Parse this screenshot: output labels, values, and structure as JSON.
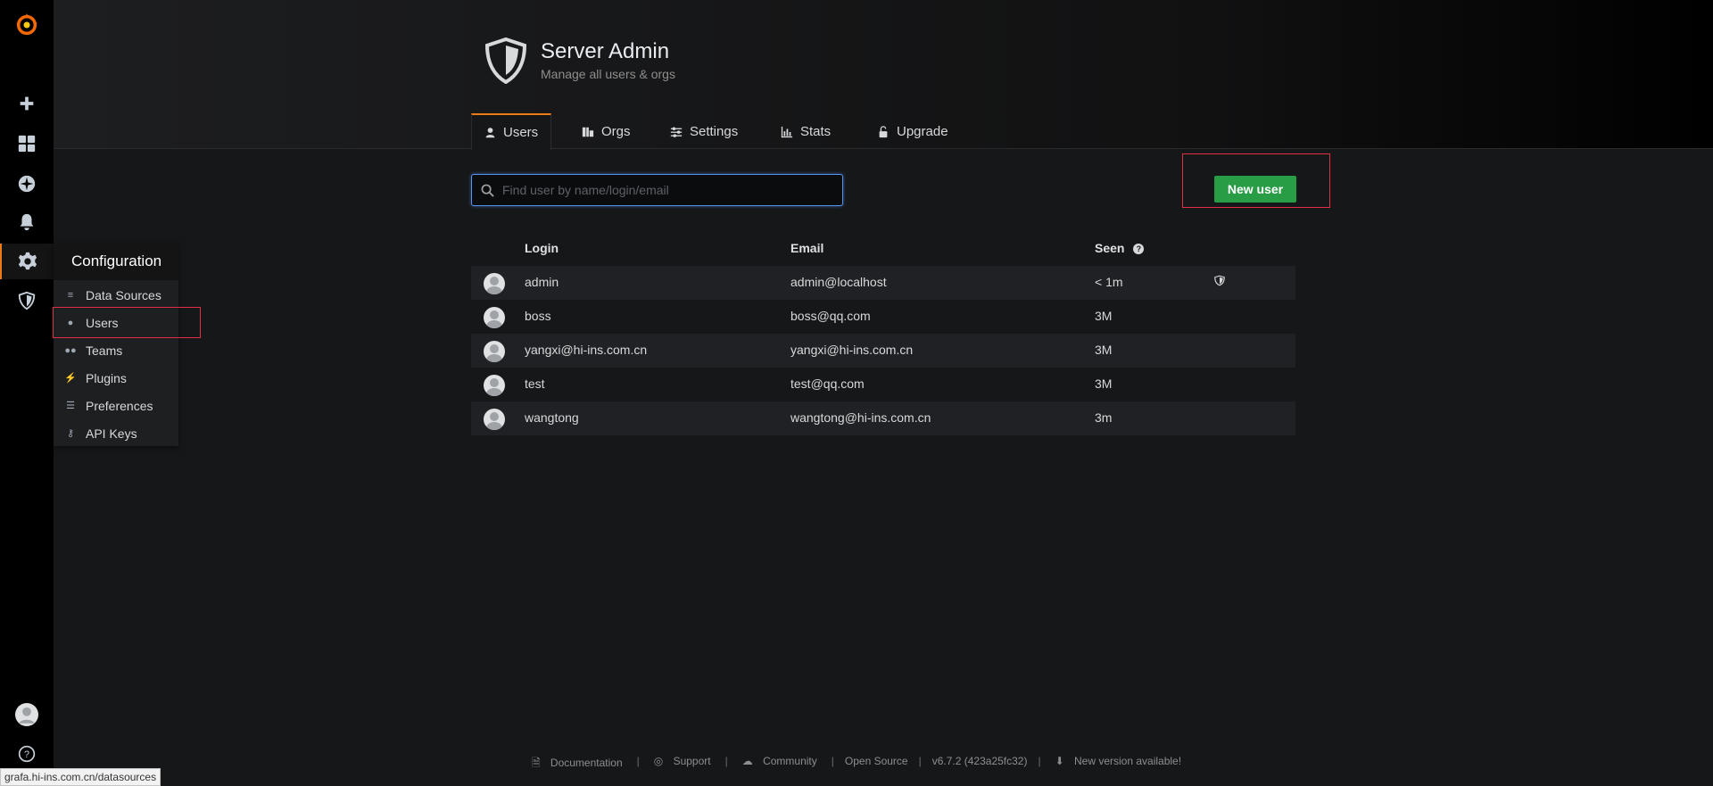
{
  "sidebar": {
    "icons": [
      "grafana-logo-icon",
      "plus-icon",
      "dashboards-icon",
      "explore-icon",
      "alerting-icon",
      "configuration-gear-icon",
      "server-admin-shield-icon",
      "user-avatar-icon",
      "help-icon"
    ]
  },
  "config_menu": {
    "title": "Configuration",
    "items": [
      {
        "label": "Data Sources",
        "icon": "database-icon"
      },
      {
        "label": "Users",
        "icon": "user-icon"
      },
      {
        "label": "Teams",
        "icon": "users-icon"
      },
      {
        "label": "Plugins",
        "icon": "plug-icon"
      },
      {
        "label": "Preferences",
        "icon": "sliders-icon"
      },
      {
        "label": "API Keys",
        "icon": "key-icon"
      }
    ]
  },
  "header": {
    "title": "Server Admin",
    "subtitle": "Manage all users & orgs",
    "tabs": [
      {
        "label": "Users",
        "icon": "user-icon",
        "active": true
      },
      {
        "label": "Orgs",
        "icon": "building-icon",
        "active": false
      },
      {
        "label": "Settings",
        "icon": "sliders-icon",
        "active": false
      },
      {
        "label": "Stats",
        "icon": "bar-chart-icon",
        "active": false
      },
      {
        "label": "Upgrade",
        "icon": "unlock-icon",
        "active": false
      }
    ]
  },
  "search": {
    "placeholder": "Find user by name/login/email",
    "value": ""
  },
  "new_user_button": "New user",
  "table": {
    "columns": [
      "Login",
      "Email",
      "Seen"
    ],
    "rows": [
      {
        "login": "admin",
        "email": "admin@localhost",
        "seen": "< 1m",
        "is_admin": true
      },
      {
        "login": "boss",
        "email": "boss@qq.com",
        "seen": "3M",
        "is_admin": false
      },
      {
        "login": "yangxi@hi-ins.com.cn",
        "email": "yangxi@hi-ins.com.cn",
        "seen": "3M",
        "is_admin": false
      },
      {
        "login": "test",
        "email": "test@qq.com",
        "seen": "3M",
        "is_admin": false
      },
      {
        "login": "wangtong",
        "email": "wangtong@hi-ins.com.cn",
        "seen": "3m",
        "is_admin": false
      }
    ]
  },
  "footer": {
    "documentation": "Documentation",
    "support": "Support",
    "community": "Community",
    "open_source": "Open Source",
    "version": "v6.7.2 (423a25fc32)",
    "new_version": "New version available!"
  },
  "status_url": "grafa.hi-ins.com.cn/datasources",
  "colors": {
    "accent": "#eb7b18",
    "primary_button": "#299c46",
    "highlight": "#e02f44",
    "focus": "#5794f2"
  }
}
